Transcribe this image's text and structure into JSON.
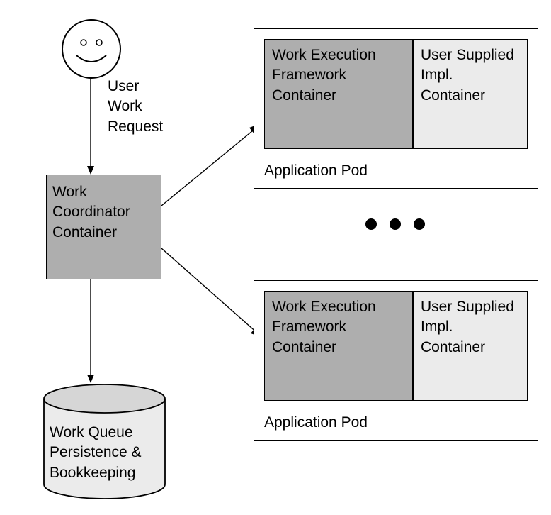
{
  "user_label_line1": "User",
  "user_label_line2": "Work",
  "user_label_line3": "Request",
  "coordinator": "Work Coordinator Container",
  "pod_label": "Application Pod",
  "exec_container": "Work Execution Framework Container",
  "user_container": "User Supplied Impl. Container",
  "queue_label": "Work Queue Persistence & Bookkeeping"
}
